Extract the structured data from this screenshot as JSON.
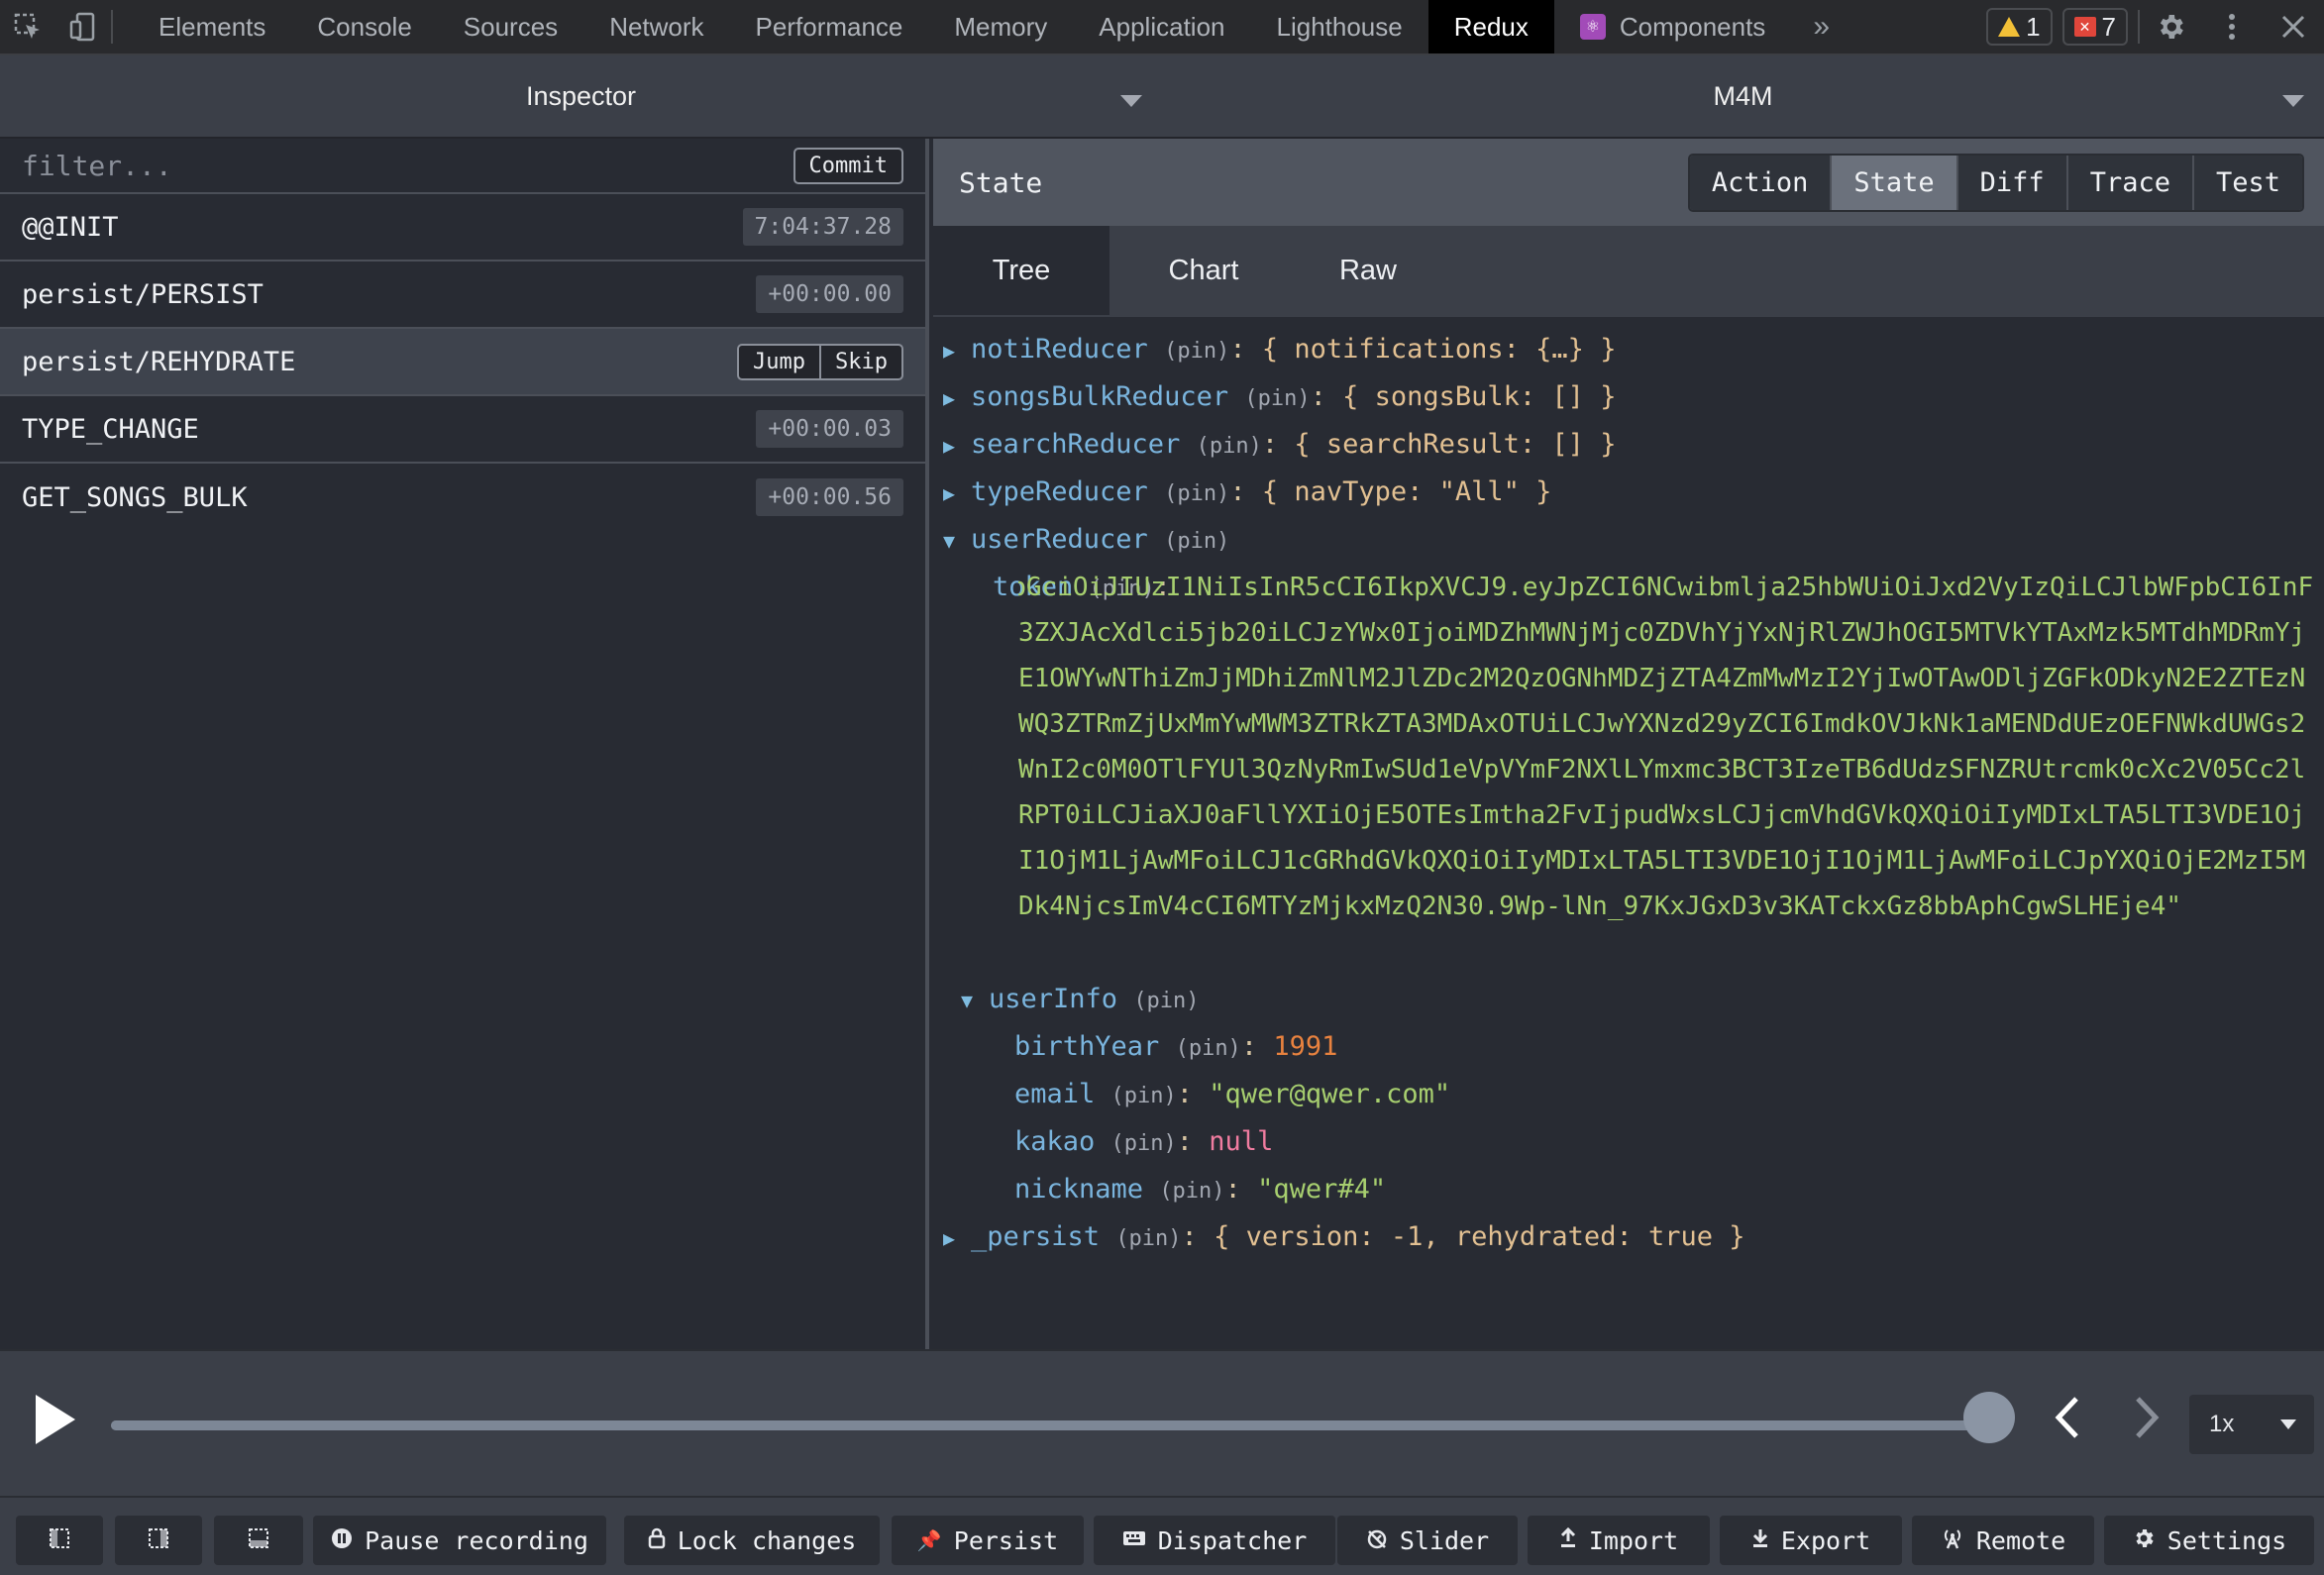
{
  "devtools": {
    "tabs": [
      "Elements",
      "Console",
      "Sources",
      "Network",
      "Performance",
      "Memory",
      "Application",
      "Lighthouse",
      "Redux",
      "Components"
    ],
    "active_tab": "Redux",
    "more_label": "»",
    "warnings_count": "1",
    "errors_count": "7",
    "icons": [
      "inspect-element-icon",
      "device-toolbar-icon",
      "gear-icon",
      "kebab-menu-icon",
      "close-icon"
    ]
  },
  "selectors": {
    "monitor": "Inspector",
    "instance": "M4M"
  },
  "actions_panel": {
    "filter_placeholder": "filter...",
    "commit_label": "Commit",
    "jump_label": "Jump",
    "skip_label": "Skip",
    "actions": [
      {
        "name": "@@INIT",
        "time": "7:04:37.28"
      },
      {
        "name": "persist/PERSIST",
        "time": "+00:00.00"
      },
      {
        "name": "persist/REHYDRATE",
        "time": ""
      },
      {
        "name": "TYPE_CHANGE",
        "time": "+00:00.03"
      },
      {
        "name": "GET_SONGS_BULK",
        "time": "+00:00.56"
      }
    ]
  },
  "state_panel": {
    "title": "State",
    "modes": [
      "Action",
      "State",
      "Diff",
      "Trace",
      "Test"
    ],
    "active_mode": "State",
    "views": [
      "Tree",
      "Chart",
      "Raw"
    ],
    "active_view": "Tree",
    "pin_label": "(pin)",
    "tree": {
      "notiReducer": {
        "key": "notiReducer",
        "preview": "{ notifications: {…} }"
      },
      "songsBulkReducer": {
        "key": "songsBulkReducer",
        "preview": "{ songsBulk: [] }"
      },
      "searchReducer": {
        "key": "searchReducer",
        "preview": "{ searchResult: [] }"
      },
      "typeReducer": {
        "key": "typeReducer",
        "preview": "{ navType: \"All\" }"
      },
      "userReducer": {
        "key": "userReducer"
      },
      "token": {
        "key": "token",
        "value": "\"eyJhbGciOiJIUzI1NiIsInR5cCI6IkpXVCJ9.eyJpZCI6NCwibmlja25hbWUiOiJxd2VyIzQiLCJlbWFpbCI6InF3ZXJAcXdlci5jb20iLCJzYWx0IjoiMDZhMWNjMjc0ZDVhYjYxNjRlZWJhOGI5MTVkYTAxMzk5MTdhMDRmYjE1OWYwNThiZmJjMDhiZmNlM2JlZDc2M2QzOGNhMDZjZTA4ZmMwMzI2YjIwOTAwODljZGFkODkyN2E2ZTEzNWQ3ZTRmZjUxMmYwMWM3ZTRkZTA3MDAxOTUiLCJwYXNzd29yZCI6ImdkOVJkNk1aMENDdUEzOEFNWkdUWGs2WnI2c0M0OTlFYUl3QzNyRmIwSUd1eVpVYmF2NXlLYmxmc3BCT3IzeTB6dUdzSFNZRUtrcmk0cXc2V05Cc2lRPT0iLCJiaXJ0aFllYXIiOjE5OTEsImtha2FvIjpudWxsLCJjcmVhdGVkQXQiOiIyMDIxLTA5LTI3VDE1OjI1OjM1LjAwMFoiLCJ1cGRhdGVkQXQiOiIyMDIxLTA5LTI3VDE1OjI1OjM1LjAwMFoiLCJpYXQiOjE2MzI5MDk4NjcsImV4cCI6MTYzMjkxMzQ2N30.9Wp-lNn_97KxJGxD3v3KATckxGz8bbAphCgwSLHEje4\""
      },
      "userInfo": {
        "key": "userInfo"
      },
      "birthYear": {
        "key": "birthYear",
        "value": "1991"
      },
      "email": {
        "key": "email",
        "value": "\"qwer@qwer.com\""
      },
      "kakao": {
        "key": "kakao",
        "value": "null"
      },
      "nickname": {
        "key": "nickname",
        "value": "\"qwer#4\""
      },
      "persist": {
        "key": "_persist",
        "preview": "{ version: -1, rehydrated: true }"
      }
    }
  },
  "playback": {
    "progress": 1.0,
    "speed": "1x"
  },
  "toolbar": {
    "buttons": [
      {
        "label": "",
        "icon": "dock-left-icon"
      },
      {
        "label": "",
        "icon": "dock-right-icon"
      },
      {
        "label": "",
        "icon": "dock-bottom-icon"
      },
      {
        "label": "Pause recording",
        "icon": "pause-icon"
      },
      {
        "label": "Lock changes",
        "icon": "lock-icon"
      },
      {
        "label": "Persist",
        "icon": "pin-icon"
      },
      {
        "label": "Dispatcher",
        "icon": "keyboard-icon"
      },
      {
        "label": "Slider",
        "icon": "stopwatch-icon"
      },
      {
        "label": "Import",
        "icon": "upload-icon"
      },
      {
        "label": "Export",
        "icon": "download-icon"
      },
      {
        "label": "Remote",
        "icon": "antenna-icon"
      },
      {
        "label": "Settings",
        "icon": "gear-icon"
      }
    ]
  },
  "colors": {
    "background": "#282b33",
    "header": "#3b3f48",
    "key": "#7ab4dd",
    "string": "#a7cf6f",
    "number": "#e8823f",
    "null": "#f07ca0"
  }
}
